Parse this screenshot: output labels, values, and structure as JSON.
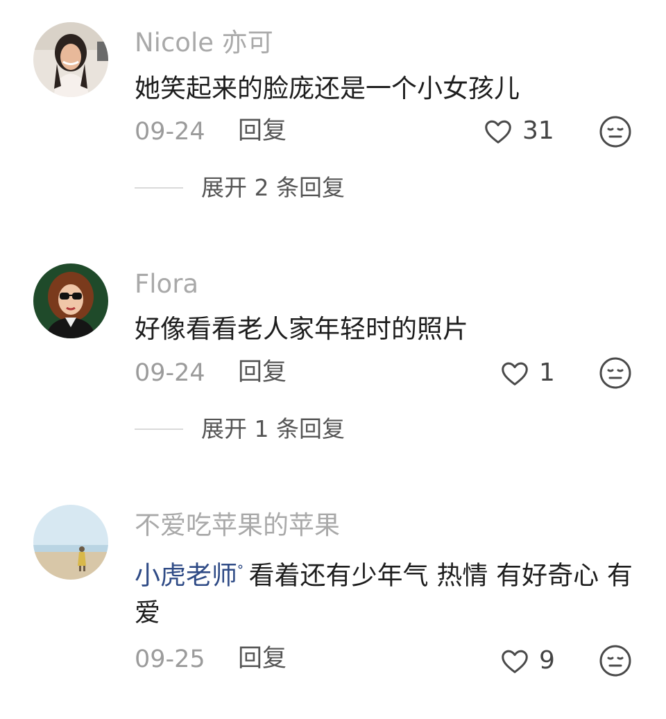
{
  "comments": [
    {
      "username": "Nicole 亦可",
      "mention": "",
      "text": "她笑起来的脸庞还是一个小女孩儿",
      "date": "09-24",
      "reply_label": "回复",
      "likes": "31",
      "expand_label": "展开 2 条回复",
      "avatar_icon": "avatar-photo-icon"
    },
    {
      "username": "Flora",
      "mention": "",
      "text": "好像看看老人家年轻时的照片",
      "date": "09-24",
      "reply_label": "回复",
      "likes": "1",
      "expand_label": "展开 1 条回复",
      "avatar_icon": "avatar-illustration-icon"
    },
    {
      "username": "不爱吃苹果的苹果",
      "mention": "小虎老师",
      "text": "看着还有少年气 热情 有好奇心 有爱",
      "date": "09-25",
      "reply_label": "回复",
      "likes": "9",
      "expand_label": "",
      "avatar_icon": "avatar-beach-icon"
    }
  ],
  "icons": {
    "like": "heart-outline-icon",
    "dislike": "neutral-face-icon",
    "mention_marker": "search-icon"
  },
  "colors": {
    "username": "#a9a9a9",
    "text": "#1e1e1e",
    "mention": "#2f4b86",
    "meta": "#9b9b9b"
  }
}
